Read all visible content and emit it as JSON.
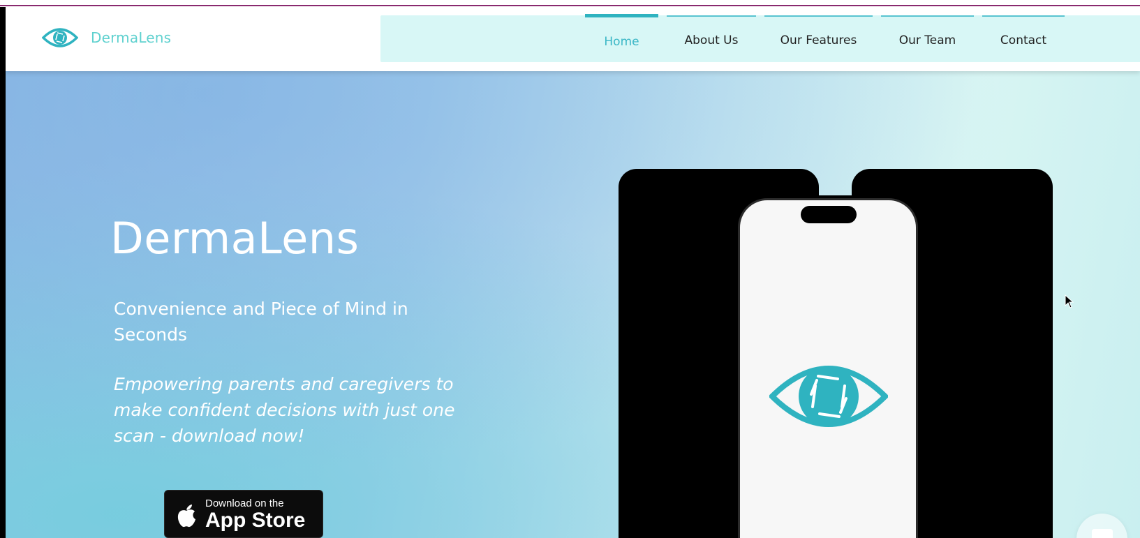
{
  "brand": {
    "name": "DermaLens",
    "logo_icon": "eye-aperture-icon"
  },
  "nav": {
    "items": [
      {
        "label": "Home",
        "active": true
      },
      {
        "label": "About Us",
        "active": false
      },
      {
        "label": "Our Features",
        "active": false
      },
      {
        "label": "Our Team",
        "active": false
      },
      {
        "label": "Contact",
        "active": false
      }
    ]
  },
  "hero": {
    "title": "DermaLens",
    "subtitle": "Convenience and Piece of Mind in Seconds",
    "tagline": "Empowering parents and caregivers to make confident decisions with just one scan - download now!",
    "app_store": {
      "small_text": "Download on the",
      "big_text": "App Store",
      "icon": "apple-icon"
    }
  },
  "mockup": {
    "screen_icon": "eye-aperture-icon"
  },
  "chat": {
    "icon": "chat-bubble-icon"
  },
  "colors": {
    "brand_teal": "#2fb3c0",
    "brand_light_teal": "#5fd1cf",
    "nav_background": "#d8f7f6",
    "hero_gradient_start": "#93bfe6",
    "hero_gradient_end": "#d8f5f3",
    "text_white": "#ffffff"
  }
}
